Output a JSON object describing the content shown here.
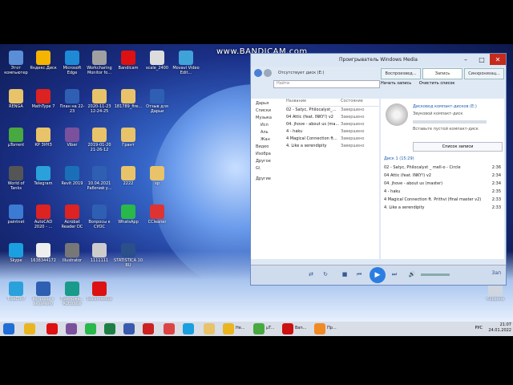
{
  "watermark": "www.BANDICAM.com",
  "desktop_icons": [
    {
      "label": "Этот компьютер",
      "color": "#5a8fd8"
    },
    {
      "label": "Яндекс.Диск",
      "color": "#f5b400"
    },
    {
      "label": "Microsoft Edge",
      "color": "#1e8ad6"
    },
    {
      "label": "Workcharing Monitor fo...",
      "color": "#a0a0a0"
    },
    {
      "label": "Bandicam",
      "color": "#d11"
    },
    {
      "label": "scale_2400",
      "color": "#dcdcdc"
    },
    {
      "label": "Movavi Video Edit...",
      "color": "#3fa3d8"
    },
    {
      "label": "RENGA",
      "color": "#e8c36a"
    },
    {
      "label": "MathType 7",
      "color": "#d22"
    },
    {
      "label": "План на 22-23",
      "color": "#2f5fb3"
    },
    {
      "label": "2020-11-23 12-24-25",
      "color": "#e8c36a"
    },
    {
      "label": "181789_fire...",
      "color": "#e8c36a"
    },
    {
      "label": "Отзыв для Дарьи",
      "color": "#2f5fb3"
    },
    {
      "label": "µTorrent",
      "color": "#48a940"
    },
    {
      "label": "КР ЗУНЗ",
      "color": "#e8c36a"
    },
    {
      "label": "Viber",
      "color": "#7b519d"
    },
    {
      "label": "2019-01-20 21-26-12",
      "color": "#e8c36a"
    },
    {
      "label": "Грант",
      "color": "#e8c36a"
    },
    {
      "label": "World of Tanks",
      "color": "#555"
    },
    {
      "label": "Telegram",
      "color": "#2aa1da"
    },
    {
      "label": "Revit 2019",
      "color": "#1b6fb8"
    },
    {
      "label": "10.04.2021 Рабочий у...",
      "color": "#2f5fb3"
    },
    {
      "label": "2222",
      "color": "#e8c36a"
    },
    {
      "label": "sp",
      "color": "#e8c36a"
    },
    {
      "label": "paintnet",
      "color": "#3b7bd3"
    },
    {
      "label": "AutoCAD 2020 - ...",
      "color": "#d22"
    },
    {
      "label": "Acrobat Reader DC",
      "color": "#d22"
    },
    {
      "label": "Вопросы к СУОС",
      "color": "#2f5fb3"
    },
    {
      "label": "WhatsApp",
      "color": "#29b84a"
    },
    {
      "label": "CCleaner",
      "color": "#d33"
    },
    {
      "label": "Skype",
      "color": "#1aa0e0"
    },
    {
      "label": "1638344172",
      "color": "#eee"
    },
    {
      "label": "Illustrator",
      "color": "#777"
    },
    {
      "label": "1111111",
      "color": "#ccc"
    },
    {
      "label": "STATISTICA 10 RU",
      "color": "#2a4f8a"
    },
    {
      "label": "TrueConf",
      "color": "#2aa1da"
    },
    {
      "label": "вопросы к экзамену",
      "color": "#2f5fb3"
    },
    {
      "label": "Приложе... Autodesk",
      "color": "#1a9a8a"
    },
    {
      "label": "bdcamsetup",
      "color": "#d11"
    }
  ],
  "recycle_bin": "Корзина",
  "wmp": {
    "title": "Проигрыватель Windows Media",
    "breadcrumb": "Отсутствует диск (E:)",
    "tabs": [
      "Воспроизвед...",
      "Запись",
      "Синхронизац..."
    ],
    "search_placeholder": "Найти",
    "actions": [
      "Начать запись",
      "Очистить список"
    ],
    "tree": [
      "Дарья",
      "Списки",
      "Музыка",
      "Исп",
      "Аль",
      "Жан",
      "Видео",
      "Изобра",
      "Другое",
      "G\\",
      "Другие"
    ],
    "list_headers": [
      "Название",
      "Состояние"
    ],
    "list_rows": [
      [
        "02 - Satyc, Philocalyst_...",
        "Завершено"
      ],
      [
        "04 Attic (feat. INKY!) v2",
        "Завершено"
      ],
      [
        "04. jhove - about us (ma...",
        "Завершено"
      ],
      [
        "4 - haku",
        "Завершено"
      ],
      [
        "4 Magical Connection ft...",
        "Завершено"
      ],
      [
        "4. Like a serendipity",
        "Завершено"
      ]
    ],
    "drive_title": "Дисковод компакт-дисков (E:)",
    "drive_sub": "Звуковой компакт-диск",
    "drive_hint": "Вставьте пустой компакт-диск",
    "burn_list_btn": "Список записи",
    "disk_header": "Диск 1 (15:29)",
    "tracks": [
      [
        "02 - Satyc, Philocalyst _ mell-o - Circle",
        "2:36"
      ],
      [
        "04 Attic (feat. INKY!) v2",
        "2:34"
      ],
      [
        "04. jhove - about us (master)",
        "2:34"
      ],
      [
        "4 - haku",
        "2:35"
      ],
      [
        "4 Magical Connection ft. Prithvi (final master v2)",
        "2:33"
      ],
      [
        "4. Like a serendipity",
        "2:33"
      ]
    ],
    "switch_label": "Зап"
  },
  "taskbar": {
    "labels": [
      "Не...",
      "µT...",
      "Ban...",
      "Пр..."
    ],
    "lang": "РУС",
    "time": "21:07",
    "date": "24.01.2022"
  }
}
